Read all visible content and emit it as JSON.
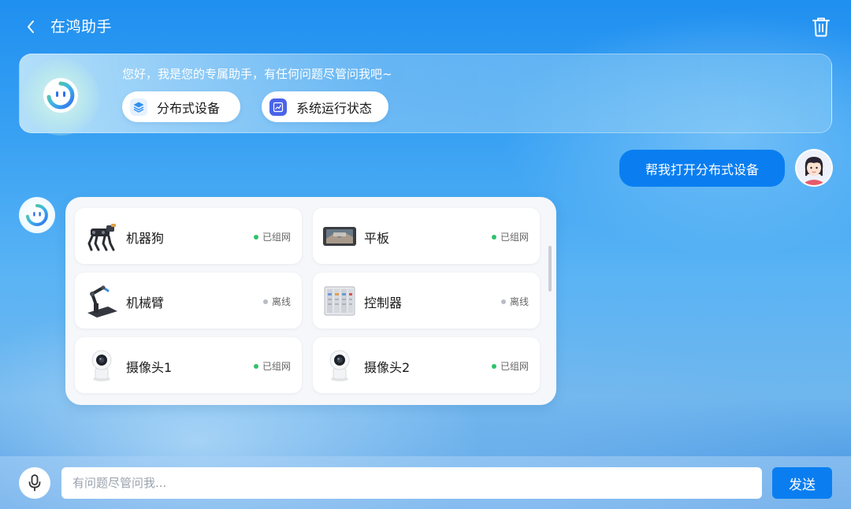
{
  "header": {
    "title": "在鸿助手",
    "back_icon": "chevron-left-icon",
    "delete_icon": "trash-icon"
  },
  "welcome": {
    "greeting": "您好，我是您的专属助手，有任何问题尽管问我吧~",
    "chips": [
      {
        "label": "分布式设备",
        "icon": "layers-icon",
        "icon_color": "#2f8ff0"
      },
      {
        "label": "系统运行状态",
        "icon": "chart-icon",
        "icon_color": "#4a63e8"
      }
    ]
  },
  "conversation": {
    "user_message": "帮我打开分布式设备",
    "devices": [
      {
        "name": "机器狗",
        "status": "已组网",
        "status_color": "#2fc26b",
        "icon": "robot-dog-icon"
      },
      {
        "name": "平板",
        "status": "已组网",
        "status_color": "#2fc26b",
        "icon": "tablet-icon"
      },
      {
        "name": "机械臂",
        "status": "离线",
        "status_color": "#b8bcc4",
        "icon": "robotic-arm-icon"
      },
      {
        "name": "控制器",
        "status": "离线",
        "status_color": "#b8bcc4",
        "icon": "controller-icon"
      },
      {
        "name": "摄像头1",
        "status": "已组网",
        "status_color": "#2fc26b",
        "icon": "camera-icon"
      },
      {
        "name": "摄像头2",
        "status": "已组网",
        "status_color": "#2fc26b",
        "icon": "camera-icon"
      }
    ]
  },
  "input": {
    "placeholder": "有问题尽管问我...",
    "send_label": "发送",
    "mic_icon": "microphone-icon"
  },
  "colors": {
    "accent": "#0a7ef0",
    "online": "#2fc26b",
    "offline": "#b8bcc4"
  }
}
